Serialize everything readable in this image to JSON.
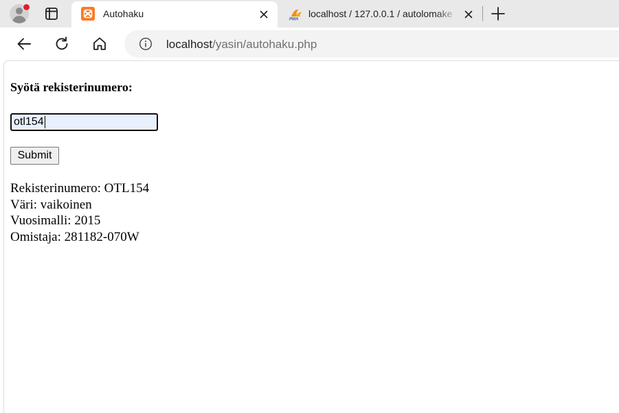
{
  "browser": {
    "tabs": [
      {
        "title": "Autohaku",
        "favicon": "xampp-icon",
        "active": true
      },
      {
        "title": "localhost / 127.0.0.1 / autolomake",
        "favicon": "phpmyadmin-icon",
        "active": false
      }
    ],
    "url": {
      "host": "localhost",
      "path": "/yasin/autohaku.php"
    },
    "colors": {
      "tabstrip": "#e9e9e9",
      "omnibox": "#f3f3f3",
      "xampp": "#fb7a24",
      "pma": "#f29111"
    }
  },
  "form": {
    "heading": "Syötä rekisterinumero:",
    "input_value": "otl154",
    "submit_label": "Submit",
    "autofill_color": "#e8f0fe"
  },
  "result": {
    "lines": [
      "Rekisterinumero: OTL154",
      "Väri: vaikoinen",
      "Vuosimalli: 2015",
      "Omistaja: 281182-070W"
    ]
  }
}
